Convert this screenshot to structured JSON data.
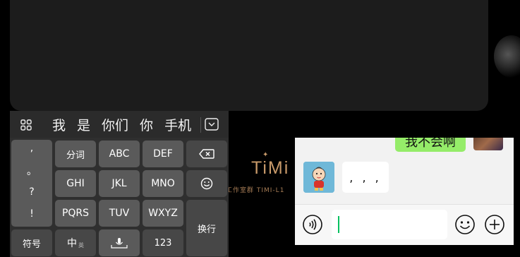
{
  "keyboard": {
    "candidates": [
      "我",
      "是",
      "你们",
      "你",
      "手机"
    ],
    "punctuation": [
      ",",
      "。",
      "?",
      "!"
    ],
    "keys": {
      "fenci": "分词",
      "abc": "ABC",
      "def": "DEF",
      "ghi": "GHI",
      "jkl": "JKL",
      "mno": "MNO",
      "pqrs": "PQRS",
      "tuv": "TUV",
      "wxyz": "WXYZ",
      "enter": "换行",
      "symbols": "符号",
      "lang_main": "中",
      "lang_sub": "英",
      "numbers": "123"
    }
  },
  "background": {
    "brand_name": "TiMi",
    "brand_sub": "工作室群 TIMI-L1"
  },
  "chat": {
    "outgoing_message": "我不会啊",
    "incoming_message": ", , ,"
  },
  "colors": {
    "accent_green": "#07c160",
    "bubble_green": "#95ec69",
    "brand_gold": "#c89a6a"
  }
}
